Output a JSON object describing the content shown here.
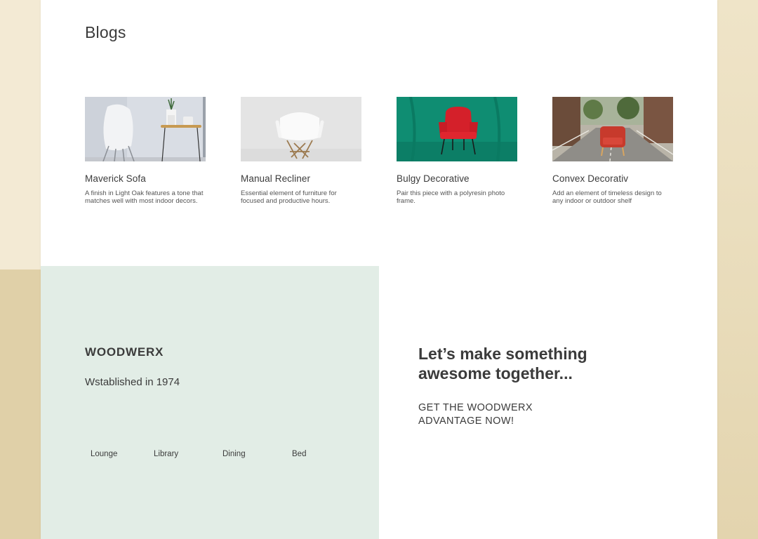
{
  "blogs": {
    "title": "Blogs",
    "cards": [
      {
        "title": "Maverick Sofa",
        "description": "A finish in Light Oak features a tone that matches well with most indoor decors.",
        "image": "white-chair-side-table-photo"
      },
      {
        "title": "Manual Recliner",
        "description": "Essential element of furniture for focused and productive hours.",
        "image": "white-shell-chair-photo"
      },
      {
        "title": "Bulgy Decorative",
        "description": "Pair this piece with a polyresin photo frame.",
        "image": "red-chair-green-backdrop-photo"
      },
      {
        "title": "Convex Decorativ",
        "description": "Add an element of timeless design to any indoor or outdoor shelf",
        "image": "red-armchair-street-photo"
      }
    ]
  },
  "footer": {
    "brand": "WOODWERX",
    "tagline": "Wstablished in 1974",
    "nav": [
      "Lounge",
      "Library",
      "Dining",
      "Bed"
    ],
    "cta_heading": "Let’s make something awesome together...",
    "cta_sub": "GET THE WOODWERX ADVANTAGE NOW!"
  },
  "colors": {
    "page_bg": "#ffffff",
    "footer_panel": "#e2ede6",
    "text": "#3b3b3b",
    "backdrop": "#ece0c4"
  }
}
